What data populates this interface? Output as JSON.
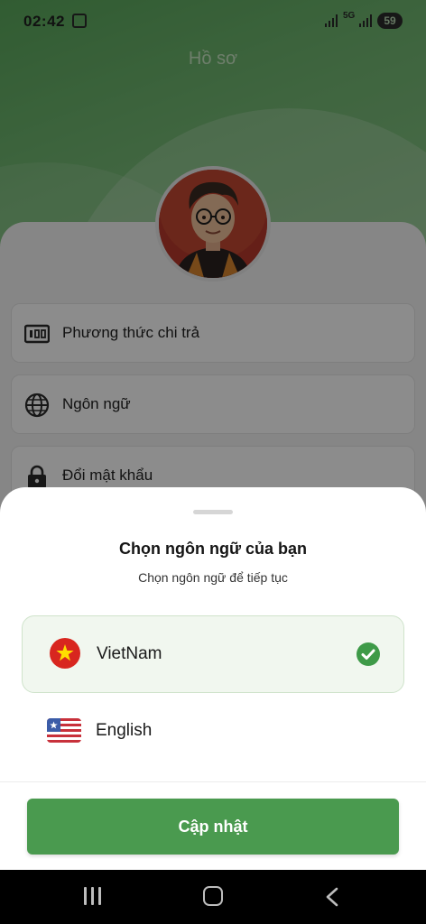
{
  "status_bar": {
    "time": "02:42",
    "network": "5G",
    "battery": "59"
  },
  "profile": {
    "title": "Hồ sơ",
    "menu": [
      {
        "label": "Phương thức chi trả",
        "icon": "payment-icon"
      },
      {
        "label": "Ngôn ngữ",
        "icon": "globe-icon"
      },
      {
        "label": "Đổi mật khẩu",
        "icon": "lock-icon"
      }
    ]
  },
  "language_sheet": {
    "title": "Chọn ngôn ngữ của bạn",
    "subtitle": "Chọn ngôn ngữ để tiếp tục",
    "options": [
      {
        "label": "VietNam",
        "icon": "vietnam-flag-icon",
        "selected": true
      },
      {
        "label": "English",
        "icon": "english-flag-icon",
        "selected": false
      }
    ],
    "update_button": "Cập nhật"
  },
  "nav_bar": {
    "icons": [
      "recent-apps-icon",
      "home-icon",
      "back-icon"
    ]
  },
  "colors": {
    "primary_green": "#4a9a4f",
    "check_green": "#3e9a48",
    "selected_bg": "#f1f7ef",
    "vn_red": "#d8261f",
    "vn_star": "#ffde00"
  }
}
